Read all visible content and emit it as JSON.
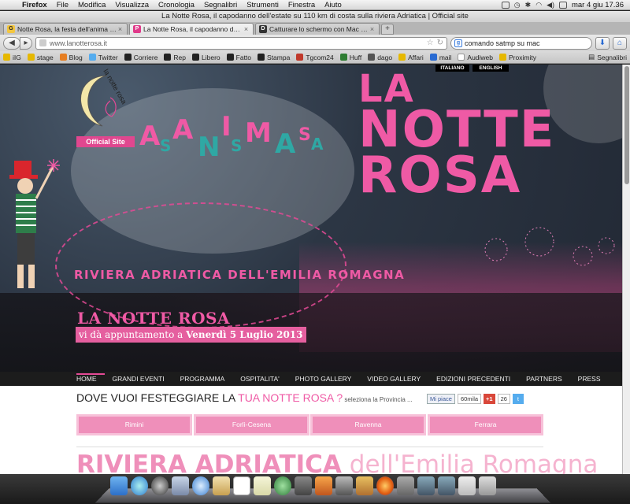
{
  "menubar": {
    "app": "Firefox",
    "items": [
      "File",
      "Modifica",
      "Visualizza",
      "Cronologia",
      "Segnalibri",
      "Strumenti",
      "Finestra",
      "Aiuto"
    ],
    "clock": "mar 4 giu  17.36"
  },
  "window": {
    "title": "La Notte Rosa, il capodanno dell'estate su 110 km di costa sulla riviera Adriatica | Official site"
  },
  "tabs": [
    {
      "title": "Notte Rosa, la festa dell'anima s...",
      "icon": "G"
    },
    {
      "title": "La Notte Rosa, il capodanno dell...",
      "icon": "P"
    },
    {
      "title": "Catturare lo schermo con Mac O...",
      "icon": "D"
    }
  ],
  "nav": {
    "url": "www.lanotterosa.it",
    "search_value": "comando satmp su mac"
  },
  "bookmarks": {
    "items": [
      {
        "label": "iIG",
        "color": "#e6b800"
      },
      {
        "label": "stage",
        "color": "#e6b800"
      },
      {
        "label": "Blog",
        "color": "#e67e22"
      },
      {
        "label": "Twitter",
        "color": "#55acee"
      },
      {
        "label": "Corriere",
        "color": "#222222"
      },
      {
        "label": "Rep",
        "color": "#222222"
      },
      {
        "label": "Libero",
        "color": "#222222"
      },
      {
        "label": "Fatto",
        "color": "#222222"
      },
      {
        "label": "Stampa",
        "color": "#222222"
      },
      {
        "label": "Tgcom24",
        "color": "#c0392b"
      },
      {
        "label": "Huff",
        "color": "#2e7d32"
      },
      {
        "label": "dago",
        "color": "#555555"
      },
      {
        "label": "Affari",
        "color": "#e6b800"
      },
      {
        "label": "mail",
        "color": "#2a6bd2"
      },
      {
        "label": "Audiweb",
        "color": "#ffffff"
      },
      {
        "label": "Proximity",
        "color": "#e6b800"
      }
    ],
    "right_label": "Segnalibri"
  },
  "site": {
    "lang": [
      "ITALIANO",
      "ENGLISH"
    ],
    "brand_small": "la notte rosa",
    "official": "Official Site",
    "title_line1": "LA",
    "title_line2": "NOTTE",
    "title_line3": "ROSA",
    "riviera_line": "RIVIERA ADRIATICA DELL'EMILIA ROMAGNA",
    "hero_title": "LA NOTTE ROSA",
    "hero_sub_pre": "vi dà appuntamento a ",
    "hero_sub_date": "Venerdì 5 Luglio 2013",
    "menu": [
      "HOME",
      "GRANDI EVENTI",
      "PROGRAMMA",
      "OSPITALITA'",
      "PHOTO GALLERY",
      "VIDEO GALLERY",
      "EDIZIONI PRECEDENTI",
      "PARTNERS",
      "PRESS"
    ],
    "dove_pre": "DOVE VUOI FESTEGGIARE LA ",
    "dove_hl": "TUA NOTTE ROSA ?",
    "dove_small": " seleziona la Provincia ...",
    "social": {
      "fb": "Mi piace",
      "fb_count": "60mila",
      "gplus": "+1",
      "gcount": "26"
    },
    "provinces": [
      "Rimini",
      "Forlì-Cesena",
      "Ravenna",
      "Ferrara"
    ],
    "riviera_big_a": "RIVIERA ADRIATICA",
    "riviera_big_b": " dell'Emilia Romagna"
  },
  "colors": {
    "brand_pink": "#ef5aa5",
    "nav_bg": "#1c1c1c"
  }
}
